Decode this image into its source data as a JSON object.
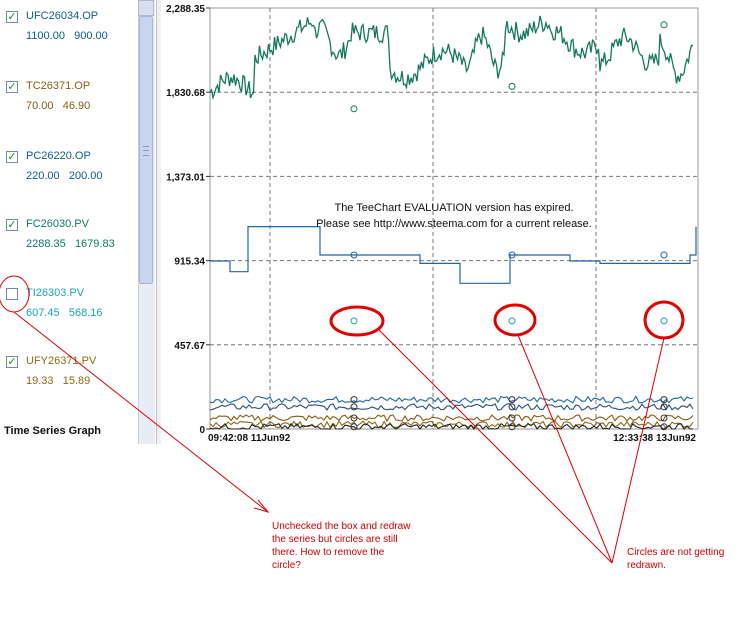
{
  "legend": {
    "title": "Time Series Graph",
    "items": [
      {
        "name": "UFC26034.OP",
        "v1": "1100.00",
        "v2": "900.00",
        "checked": true,
        "color": "#0d5c8a"
      },
      {
        "name": "TC26371.OP",
        "v1": "70.00",
        "v2": "46.90",
        "checked": true,
        "color": "#8b5a12"
      },
      {
        "name": "PC26220.OP",
        "v1": "220.00",
        "v2": "200.00",
        "checked": true,
        "color": "#0d5c8a"
      },
      {
        "name": "FC26030.PV",
        "v1": "2288.35",
        "v2": "1679.83",
        "checked": true,
        "color": "#0d7a66"
      },
      {
        "name": "TI26303.PV",
        "v1": "607.45",
        "v2": "568.16",
        "checked": false,
        "color": "#1aa5b5"
      },
      {
        "name": "UFY26371.PV",
        "v1": "19.33",
        "v2": "15.89",
        "checked": true,
        "color": "#8b6a12"
      }
    ]
  },
  "chart": {
    "y_ticks": [
      "2,288.35",
      "1,830.68",
      "1,373.01",
      "915.34",
      "457.67",
      "0"
    ],
    "x_start": "09:42:08 11Jun92",
    "x_end": "12:33:38 13Jun92",
    "watermark_line1": "The TeeChart EVALUATION version has expired.",
    "watermark_line2": "Please see http://www.steema.com for a current release."
  },
  "chart_data": {
    "type": "line",
    "ylim": [
      0,
      2288.35
    ],
    "x": [
      "09:42:08 11Jun92",
      "12:33:38 13Jun92"
    ],
    "series": [
      {
        "name": "FC26030.PV",
        "color": "#14785e",
        "level_range": [
          1679.83,
          2288.35
        ]
      },
      {
        "name": "UFC26034.OP",
        "color": "#2165a8",
        "levels": [
          900.0,
          1100.0
        ]
      },
      {
        "name": "TI26303.PV",
        "color": "#1aa5b5",
        "level_range": [
          568.16,
          607.45
        ]
      }
    ]
  },
  "annotations": {
    "note_left": "Unchecked the box and redraw the series but circles are still there. How to remove the circle?",
    "note_right": "Circles are not getting redrawn.",
    "color": "#d00000"
  }
}
